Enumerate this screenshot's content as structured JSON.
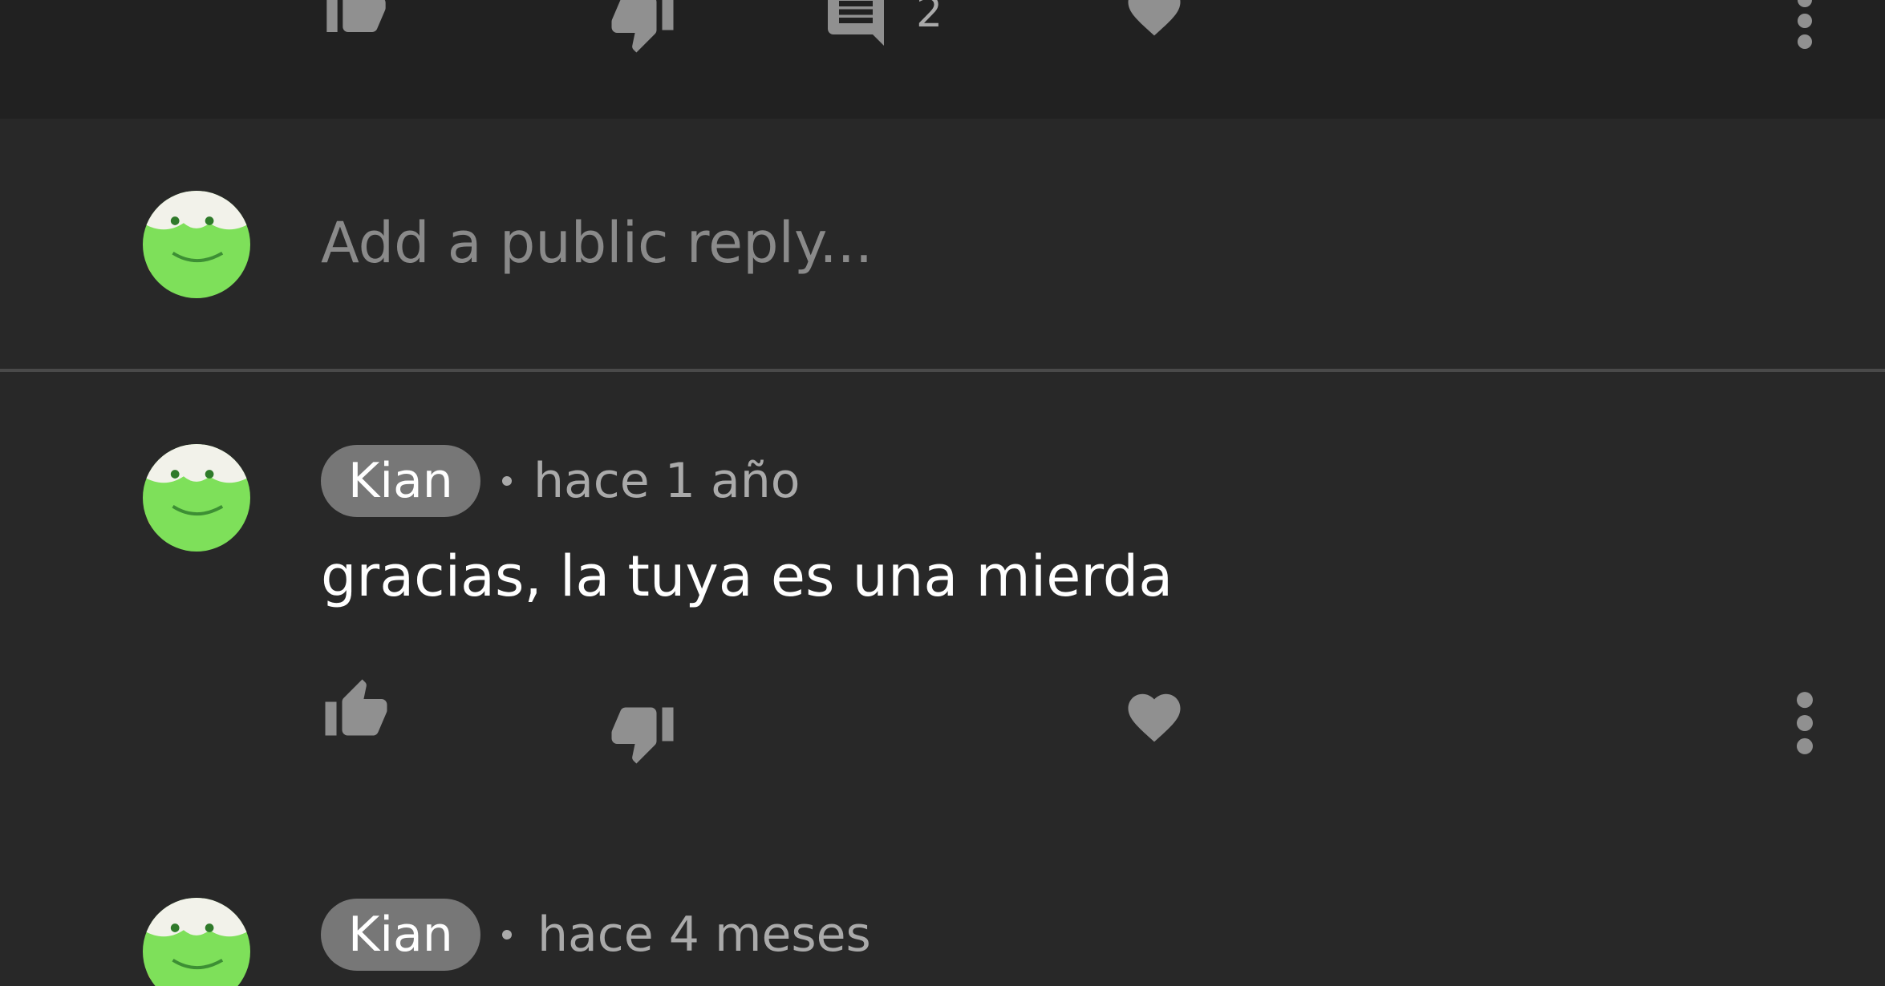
{
  "previous_comment_actions": {
    "reply_count": "2"
  },
  "reply_box": {
    "placeholder": "Add a public reply..."
  },
  "comments": [
    {
      "author": "Kian",
      "timestamp": "hace 1 año",
      "text": "gracias, la tuya es una mierda"
    },
    {
      "author": "Kian",
      "timestamp": "hace 4 meses"
    }
  ],
  "icons": {
    "like": "thumbs-up-icon",
    "dislike": "thumbs-down-icon",
    "replies": "comment-icon",
    "heart": "heart-icon",
    "more": "more-vertical-icon"
  },
  "colors": {
    "background": "#282828",
    "top_bar": "#212121",
    "icon_gray": "#909090",
    "text_primary": "#ffffff",
    "text_secondary": "#aaaaaa",
    "badge": "#777777",
    "avatar_green": "#7ee05a"
  }
}
